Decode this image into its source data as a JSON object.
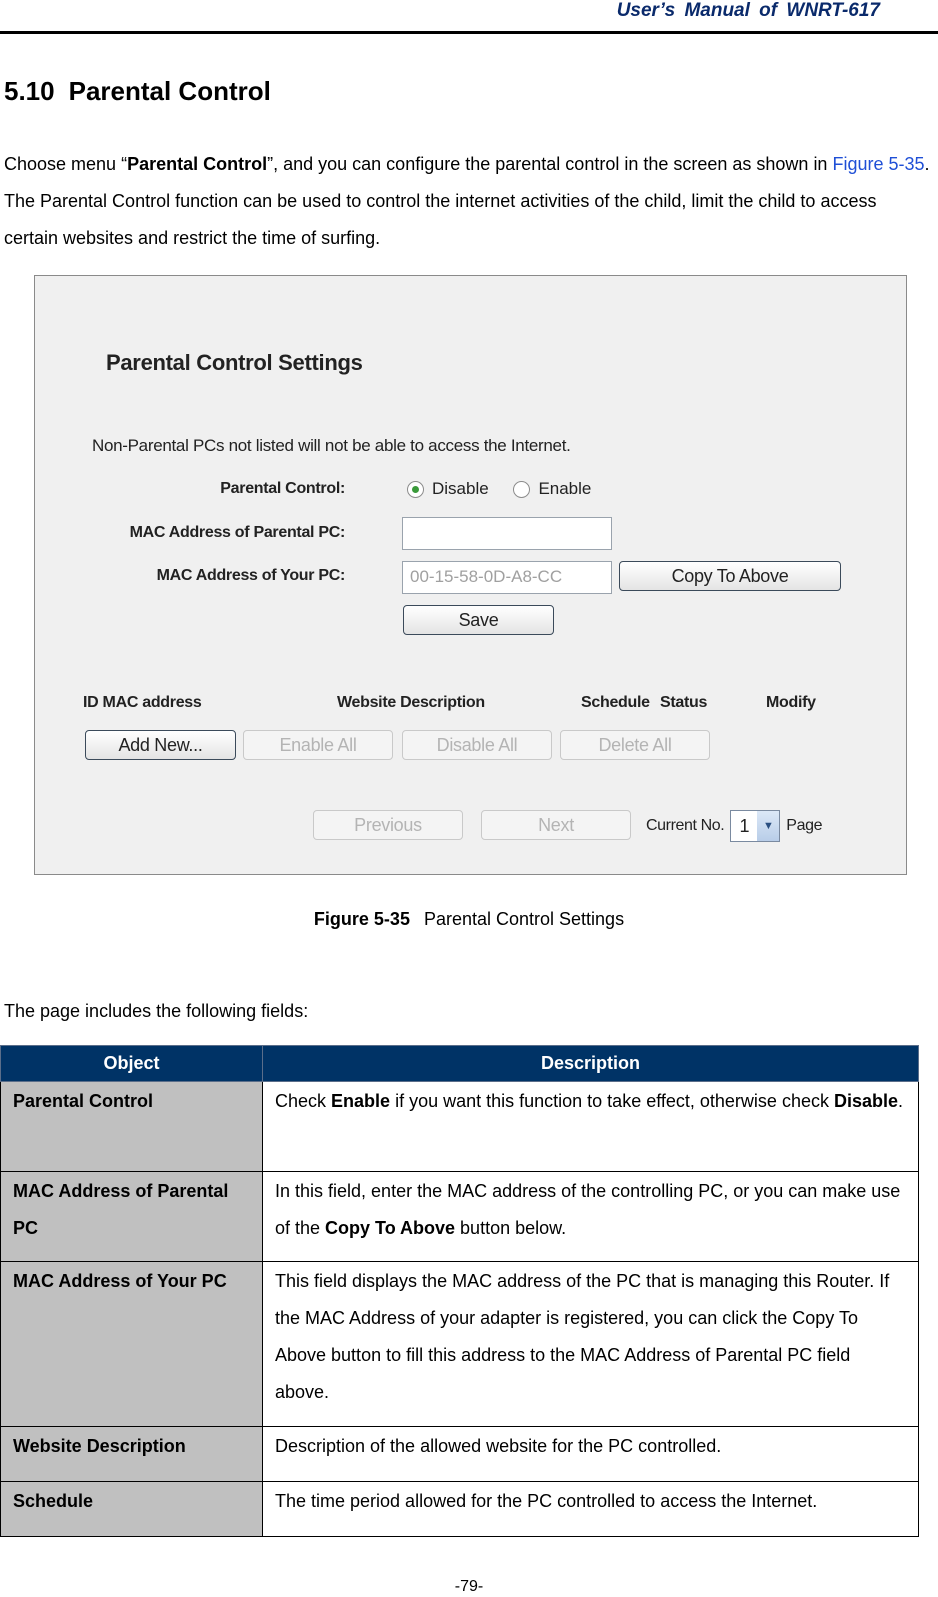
{
  "header": {
    "title": "User’s  Manual  of  WNRT-617"
  },
  "section": {
    "number": "5.10",
    "title": "Parental Control"
  },
  "intro": {
    "p1_a": "Choose menu “",
    "p1_bold": "Parental Control",
    "p1_b": "”, and you can configure the parental control in the screen as shown in ",
    "p1_link": "Figure 5-35",
    "p1_c": ". The Parental Control function can be used to control the internet activities of the child, limit the child to access certain websites and restrict the time of surfing."
  },
  "figure": {
    "title": "Parental Control Settings",
    "note": "Non-Parental PCs not listed will not be able to access the Internet.",
    "parental_control_label": "Parental Control:",
    "radio_disable": "Disable",
    "radio_enable": "Enable",
    "selected": "Disable",
    "mac_parental_label": "MAC Address of Parental PC:",
    "mac_parental_value": "",
    "mac_your_label": "MAC Address of Your PC:",
    "mac_your_value": "00-15-58-0D-A8-CC",
    "copy_button": "Copy To Above",
    "save_button": "Save",
    "columns": {
      "id_mac": "ID MAC address",
      "website": "Website Description",
      "schedule": "Schedule",
      "status": "Status",
      "modify": "Modify"
    },
    "add_new_button": "Add New...",
    "enable_all_button": "Enable All",
    "disable_all_button": "Disable All",
    "delete_all_button": "Delete All",
    "previous_button": "Previous",
    "next_button": "Next",
    "current_no_label": "Current No.",
    "current_page": "1",
    "page_label": "Page"
  },
  "caption": {
    "label": "Figure 5-35",
    "text": "Parental Control Settings"
  },
  "fields_intro": "The page includes the following fields:",
  "table": {
    "headers": {
      "object": "Object",
      "description": "Description"
    },
    "rows": [
      {
        "object": "Parental Control",
        "desc_a": "Check ",
        "desc_b1": "Enable",
        "desc_c": " if you want this function to take effect, otherwise check ",
        "desc_b2": "Disable",
        "desc_d": "."
      },
      {
        "object": "MAC Address of Parental PC",
        "desc_a": "In this field, enter the MAC address of the controlling PC, or you can make use of the ",
        "desc_b1": "Copy To Above",
        "desc_c": " button below."
      },
      {
        "object": "MAC Address of Your PC",
        "desc": "This field displays the MAC address of the PC that is managing this Router. If the MAC Address of your adapter is registered, you can click the Copy To Above button to fill this address to the MAC Address of Parental PC field above."
      },
      {
        "object": "Website Description",
        "desc": "Description of the allowed website for the PC controlled."
      },
      {
        "object": "Schedule",
        "desc": "The time period allowed for the PC controlled to access the Internet."
      }
    ]
  },
  "footer": {
    "page_number": "-79-"
  }
}
